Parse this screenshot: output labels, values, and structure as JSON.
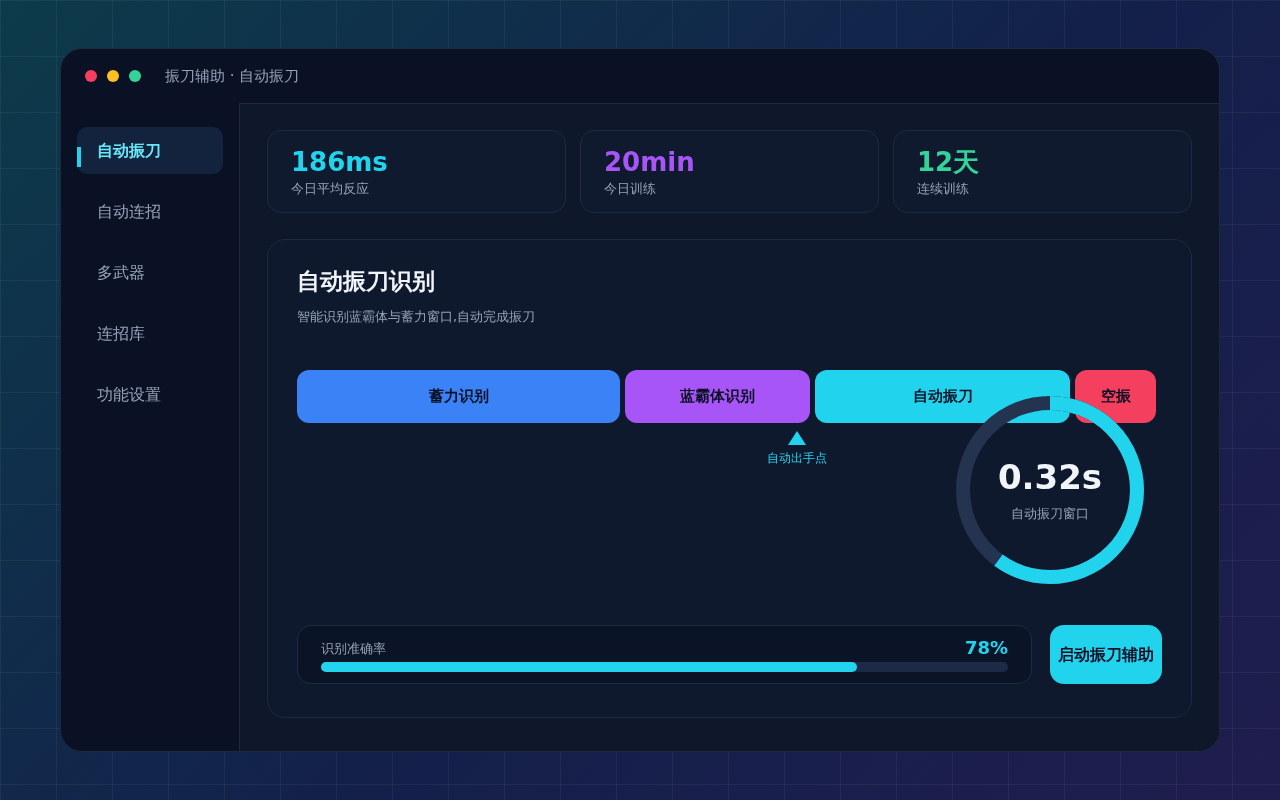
{
  "window": {
    "title": "振刀辅助 · 自动振刀"
  },
  "sidebar": {
    "items": [
      {
        "label": "自动振刀",
        "selected": true
      },
      {
        "label": "自动连招",
        "selected": false
      },
      {
        "label": "多武器",
        "selected": false
      },
      {
        "label": "连招库",
        "selected": false
      },
      {
        "label": "功能设置",
        "selected": false
      }
    ]
  },
  "stats": [
    {
      "value": "186ms",
      "label": "今日平均反应",
      "color": "#22d3ee"
    },
    {
      "value": "20min",
      "label": "今日训练",
      "color": "#a855f7"
    },
    {
      "value": "12天",
      "label": "连续训练",
      "color": "#34d399"
    }
  ],
  "panel": {
    "title": "自动振刀识别",
    "subtitle": "智能识别蓝霸体与蓄力窗口,自动完成振刀",
    "segments": [
      {
        "kind": "charge",
        "label": "蓄力识别",
        "color": "#3b82f6"
      },
      {
        "kind": "superarmor",
        "label": "蓝霸体识别",
        "color": "#a855f7"
      },
      {
        "kind": "parry",
        "label": "自动振刀",
        "color": "#22d3ee"
      },
      {
        "kind": "miss",
        "label": "空振",
        "color": "#f43f5e"
      }
    ],
    "marker": {
      "label": "自动出手点"
    },
    "gauge": {
      "value": "0.32s",
      "label": "自动振刀窗口",
      "level": 0.6
    },
    "accuracy": {
      "label": "识别准确率",
      "reading": "78%",
      "level": 0.78
    },
    "start_button": "启动振刀辅助"
  }
}
